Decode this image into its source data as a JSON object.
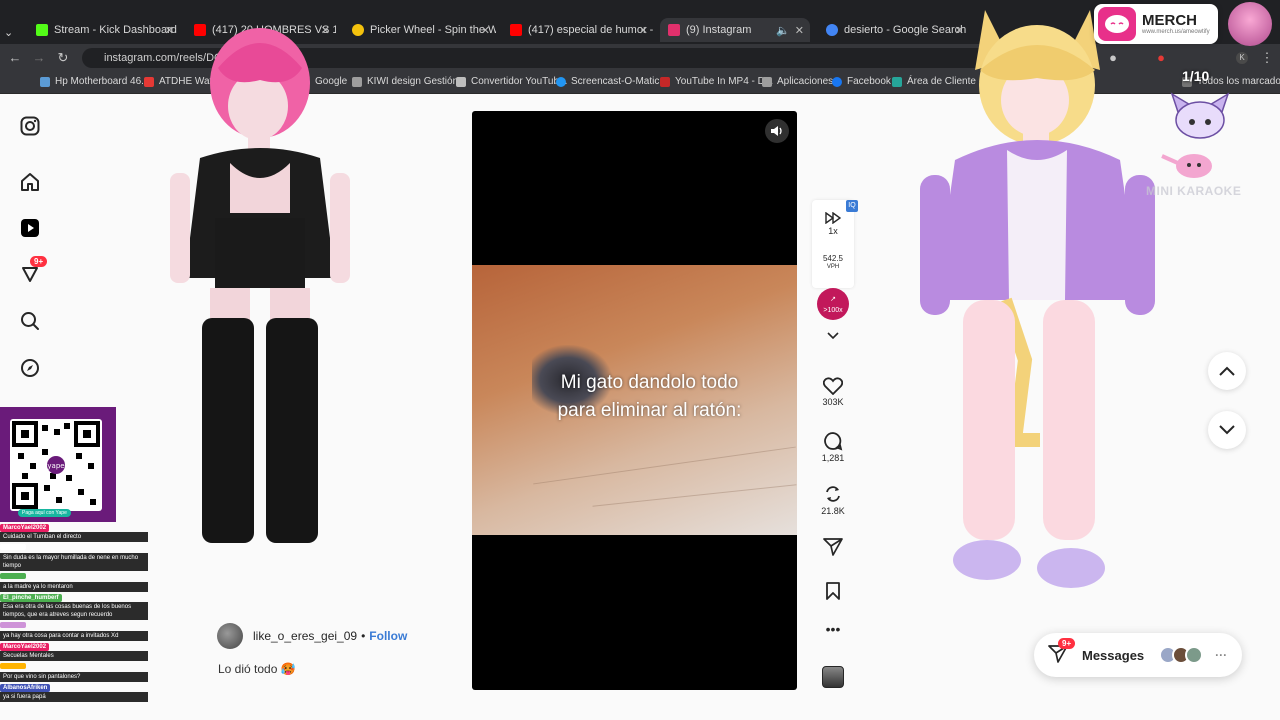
{
  "browser": {
    "tabs": [
      {
        "title": "Stream - Kick Dashboard",
        "color": "#53fc18"
      },
      {
        "title": "(417) 20 HOMBRES VS 1 ARTIS",
        "color": "#ff0000"
      },
      {
        "title": "Picker Wheel - Spin the Wheel",
        "color": "#f4c20d"
      },
      {
        "title": "(417) especial de humor - You",
        "color": "#ff0000"
      },
      {
        "title": "(9) Instagram",
        "color": "#e1306c"
      },
      {
        "title": "desierto - Google Search",
        "color": "#4285f4"
      }
    ],
    "url": "instagram.com/reels/DQky",
    "bookmarks": [
      {
        "label": "Hp Motherboard 46...",
        "color": "#5b9bd5"
      },
      {
        "label": "ATDHE Watch Li...",
        "color": "#e53935"
      },
      {
        "label": "Google",
        "color": "#4285f4"
      },
      {
        "label": "KIWI design Gestión...",
        "color": "#9e9e9e"
      },
      {
        "label": "Convertidor YouTub...",
        "color": "#bdbdbd"
      },
      {
        "label": "Screencast-O-Matic...",
        "color": "#2196f3"
      },
      {
        "label": "YouTube In MP4 - D...",
        "color": "#c62828"
      },
      {
        "label": "Aplicaciones",
        "color": "#9e9e9e"
      },
      {
        "label": "Facebook",
        "color": "#1877f2"
      },
      {
        "label": "Área de Cliente - Mi...",
        "color": "#26a69a"
      },
      {
        "label": "Todos los marcadores",
        "color": "#757575"
      }
    ]
  },
  "nav": {
    "icons": [
      "instagram-icon",
      "home-icon",
      "reels-icon",
      "activity-icon",
      "search-icon",
      "explore-icon"
    ],
    "activity_badge": "9+"
  },
  "reel": {
    "caption_line1": "Mi gato dandolo todo",
    "caption_line2": "para eliminar al ratón:",
    "speed": "1x",
    "speed_value": "542.5",
    "speed_unit": "VPH",
    "boost": ">100x",
    "likes": "303K",
    "comments": "1,281",
    "reposts": "21.8K",
    "author": "like_o_eres_gei_09",
    "separator": "•",
    "follow": "Follow",
    "post_caption": "Lo dió todo 🥵"
  },
  "messages": {
    "label": "Messages",
    "badge": "9+"
  },
  "overlay": {
    "merch_title": "MERCH",
    "merch_url": "www.merch.us/ameowtify",
    "counter": "1/10",
    "karaoke": "MINI KARAOKE",
    "qr_label": "Paga aquí con Yape"
  },
  "chat": [
    {
      "user": "MarcoYael2002",
      "user_color": "#e91e63",
      "msg": "Cuidado el Tumban el directo"
    },
    {
      "user": "",
      "user_color": "#ffffff",
      "msg": "Sin duda es la mayor humillada de nene en mucho tiempo"
    },
    {
      "user": "",
      "user_color": "#4caf50",
      "msg": "a la madre ya lo mentaron"
    },
    {
      "user": "El_pinche_humberf",
      "user_color": "#4caf50",
      "msg": "Esa era otra de las cosas buenas de los buenos tiempos, que era atreves segun recuerdo"
    },
    {
      "user": "",
      "user_color": "#ce93d8",
      "msg": "ya hay otra cosa para contar a invitados Xd"
    },
    {
      "user": "MarcoYael2002",
      "user_color": "#e91e63",
      "msg": "Secuelas Mentales"
    },
    {
      "user": "",
      "user_color": "#ffb300",
      "msg": "Por que vino sin pantalones?"
    },
    {
      "user": "AlbanosAfriken",
      "user_color": "#3f51b5",
      "msg": "ya si fuera papá"
    }
  ]
}
